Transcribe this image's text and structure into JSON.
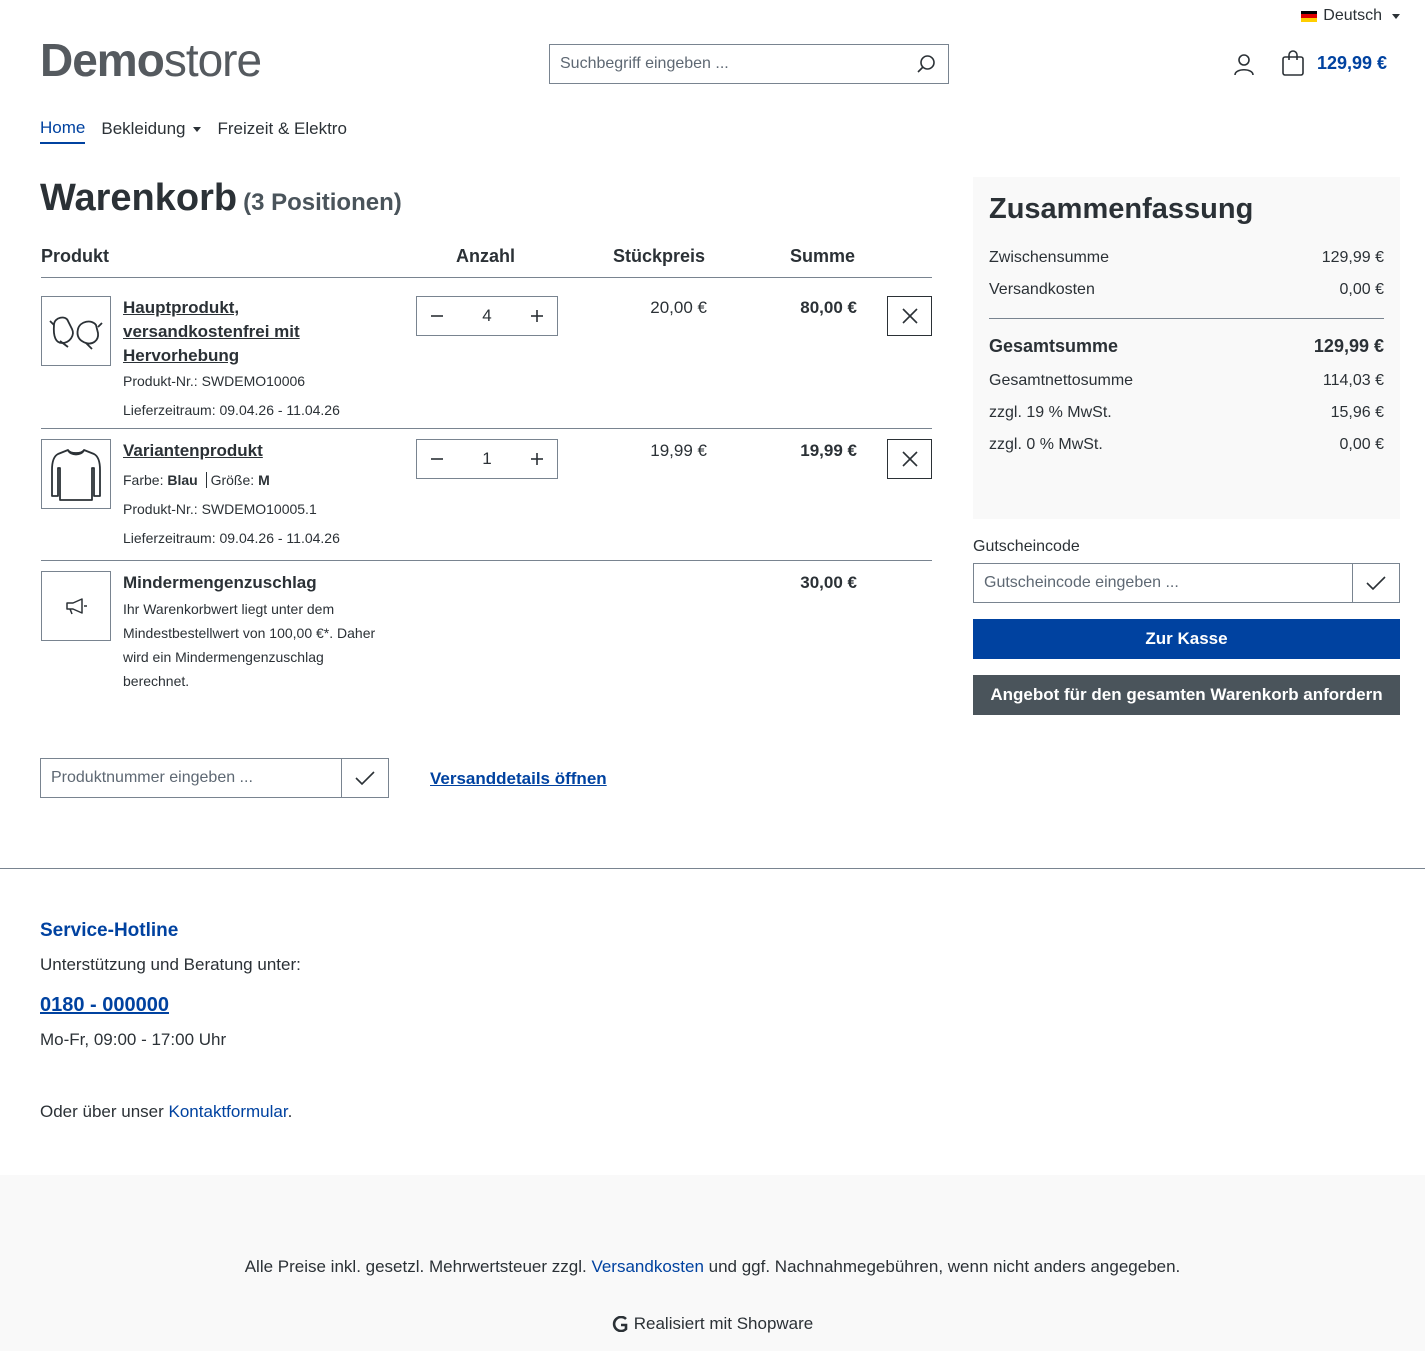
{
  "header": {
    "language": "Deutsch",
    "logo_bold": "Demo",
    "logo_light": "store",
    "search_placeholder": "Suchbegriff eingeben ...",
    "cart_total": "129,99 €"
  },
  "nav": {
    "home": "Home",
    "clothing": "Bekleidung",
    "leisure": "Freizeit & Elektro"
  },
  "cart": {
    "title": "Warenkorb",
    "count": "(3 Positionen)",
    "headers": {
      "product": "Produkt",
      "quantity": "Anzahl",
      "unit_price": "Stückpreis",
      "total": "Summe"
    },
    "items": [
      {
        "name": "Hauptprodukt, versandkostenfrei mit Hervorhebung",
        "product_number": "Produkt-Nr.: SWDEMO10006",
        "delivery": "Lieferzeitraum: 09.04.26 - 11.04.26",
        "quantity": "4",
        "unit_price": "20,00 €",
        "total": "80,00 €",
        "icon": "gloves-icon"
      },
      {
        "name": "Variantenprodukt",
        "color_label": "Farbe:",
        "color_value": "Blau",
        "size_label": "Größe:",
        "size_value": "M",
        "product_number": "Produkt-Nr.: SWDEMO10005.1",
        "delivery": "Lieferzeitraum: 09.04.26 - 11.04.26",
        "quantity": "1",
        "unit_price": "19,99 €",
        "total": "19,99 €",
        "icon": "sweater-icon"
      },
      {
        "name": "Mindermengenzuschlag",
        "description": "Ihr Warenkorbwert liegt unter dem Mindestbestellwert von 100,00 €*. Daher wird ein Mindermengenzuschlag berechnet.",
        "total": "30,00 €",
        "icon": "megaphone-icon"
      }
    ],
    "product_number_placeholder": "Produktnummer eingeben ...",
    "shipping_link": "Versanddetails öffnen"
  },
  "summary": {
    "title": "Zusammenfassung",
    "subtotal_label": "Zwischensumme",
    "subtotal": "129,99 €",
    "shipping_label": "Versandkosten",
    "shipping": "0,00 €",
    "grand_total_label": "Gesamtsumme",
    "grand_total": "129,99 €",
    "net_label": "Gesamtnettosumme",
    "net": "114,03 €",
    "vat19_label": "zzgl. 19 % MwSt.",
    "vat19": "15,96 €",
    "vat0_label": "zzgl. 0 % MwSt.",
    "vat0": "0,00 €",
    "voucher_label": "Gutscheincode",
    "voucher_placeholder": "Gutscheincode eingeben ...",
    "checkout_button": "Zur Kasse",
    "quote_button": "Angebot für den gesamten Warenkorb anfordern"
  },
  "footer": {
    "hotline_title": "Service-Hotline",
    "hotline_text": "Unterstützung und Beratung unter:",
    "phone": "0180 - 000000",
    "hours": "Mo-Fr, 09:00 - 17:00 Uhr",
    "contact_prefix": "Oder über unser ",
    "contact_link": "Kontaktformular",
    "contact_suffix": ".",
    "vat_prefix": "Alle Preise inkl. gesetzl. Mehrwertsteuer zzgl. ",
    "vat_link": "Versandkosten",
    "vat_suffix": " und ggf. Nachnahmegebühren, wenn nicht anders angegeben.",
    "powered_by": "Realisiert mit Shopware"
  },
  "colors": {
    "primary": "#0042a0",
    "secondary": "#4a545b",
    "text": "#2b3136",
    "border": "#798490",
    "surface": "#f9f9f9"
  }
}
